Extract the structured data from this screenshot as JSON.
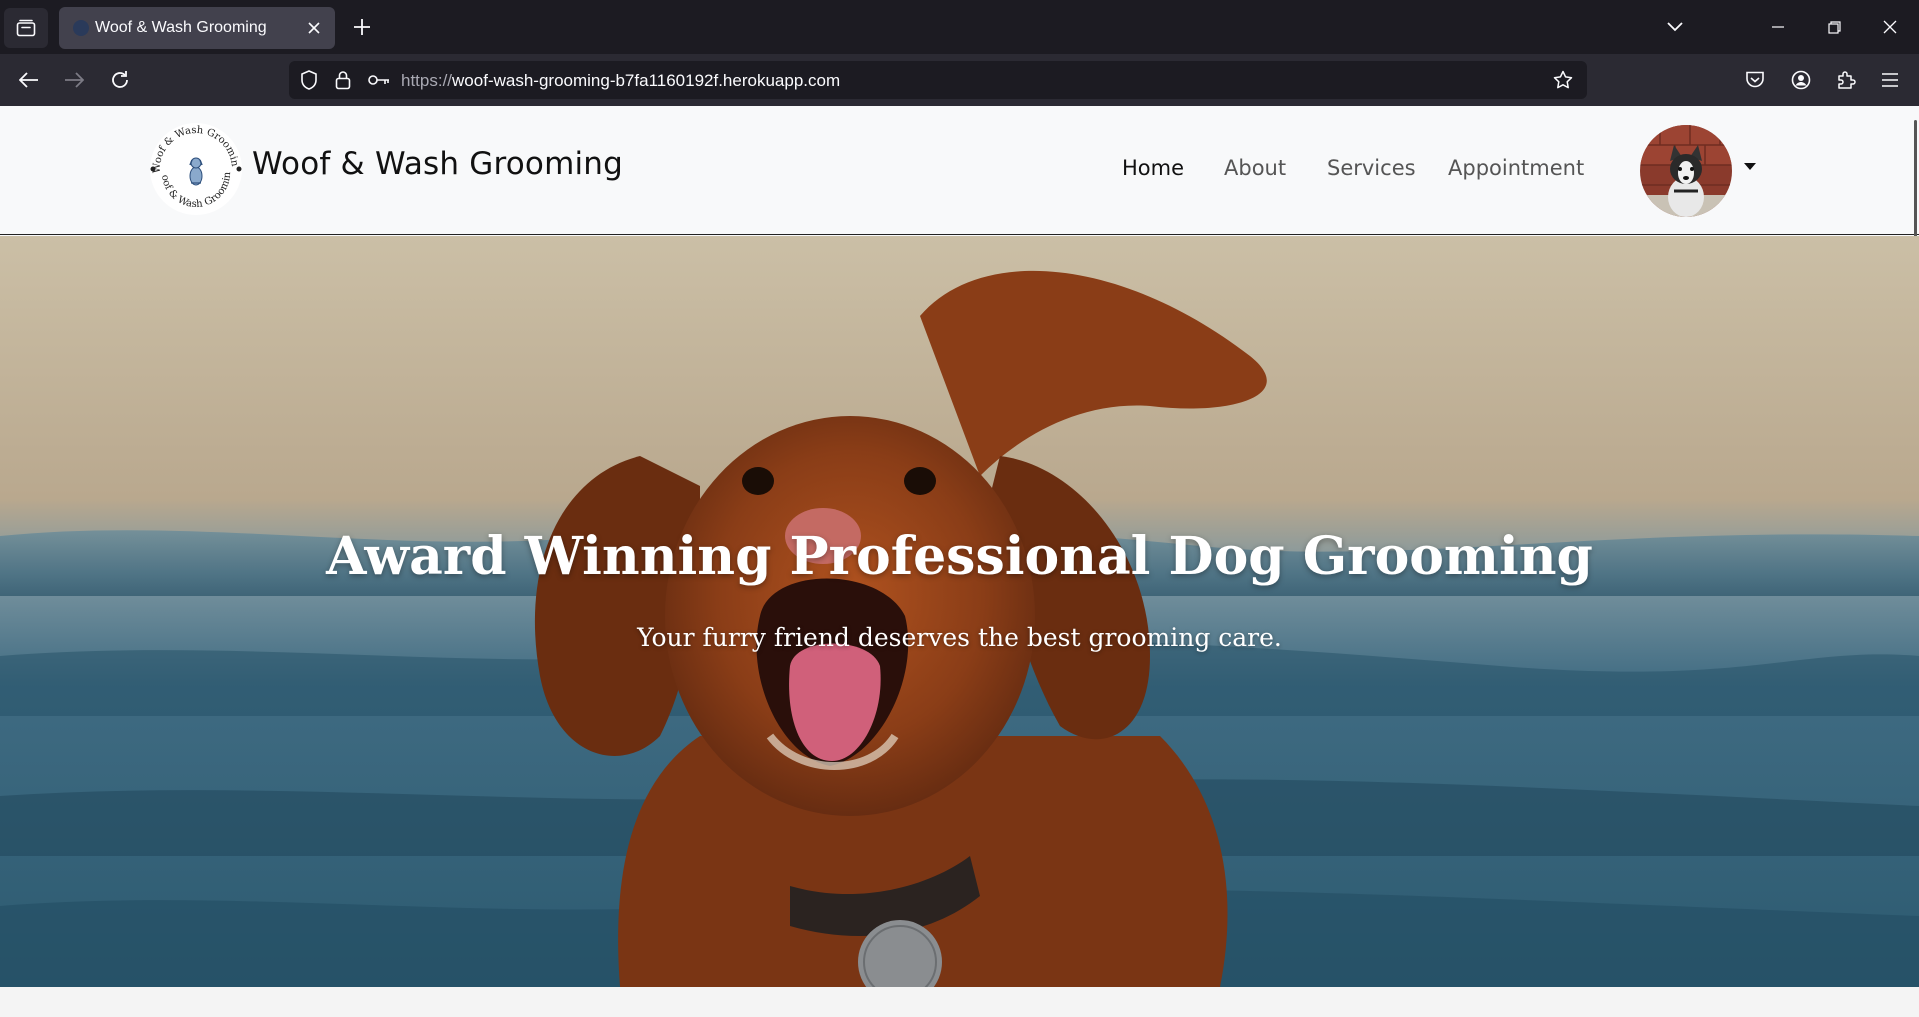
{
  "browser": {
    "tab_title": "Woof & Wash Grooming",
    "url_protocol": "https://",
    "url_host": "woof-wash-grooming-b7fa1160192f.herokuapp.com"
  },
  "site": {
    "brand": "Woof & Wash Grooming",
    "logo_text": "Woof & Wash Grooming",
    "menu": [
      {
        "label": "Home",
        "active": true
      },
      {
        "label": "About",
        "active": false
      },
      {
        "label": "Services",
        "active": false
      },
      {
        "label": "Appointment",
        "active": false
      }
    ]
  },
  "hero": {
    "title": "Award Winning Professional Dog Grooming",
    "subtitle": "Your furry friend deserves the best grooming care."
  },
  "icons": {
    "tab_list": "tab-list-icon",
    "close": "close-icon",
    "new_tab": "plus-icon",
    "back": "back-arrow-icon",
    "forward": "forward-arrow-icon",
    "reload": "reload-icon",
    "shield": "shield-icon",
    "lock": "lock-icon",
    "key": "key-icon",
    "bookmark": "star-icon",
    "pocket": "pocket-icon",
    "account": "account-icon",
    "extensions": "puzzle-icon",
    "menu": "hamburger-icon"
  }
}
